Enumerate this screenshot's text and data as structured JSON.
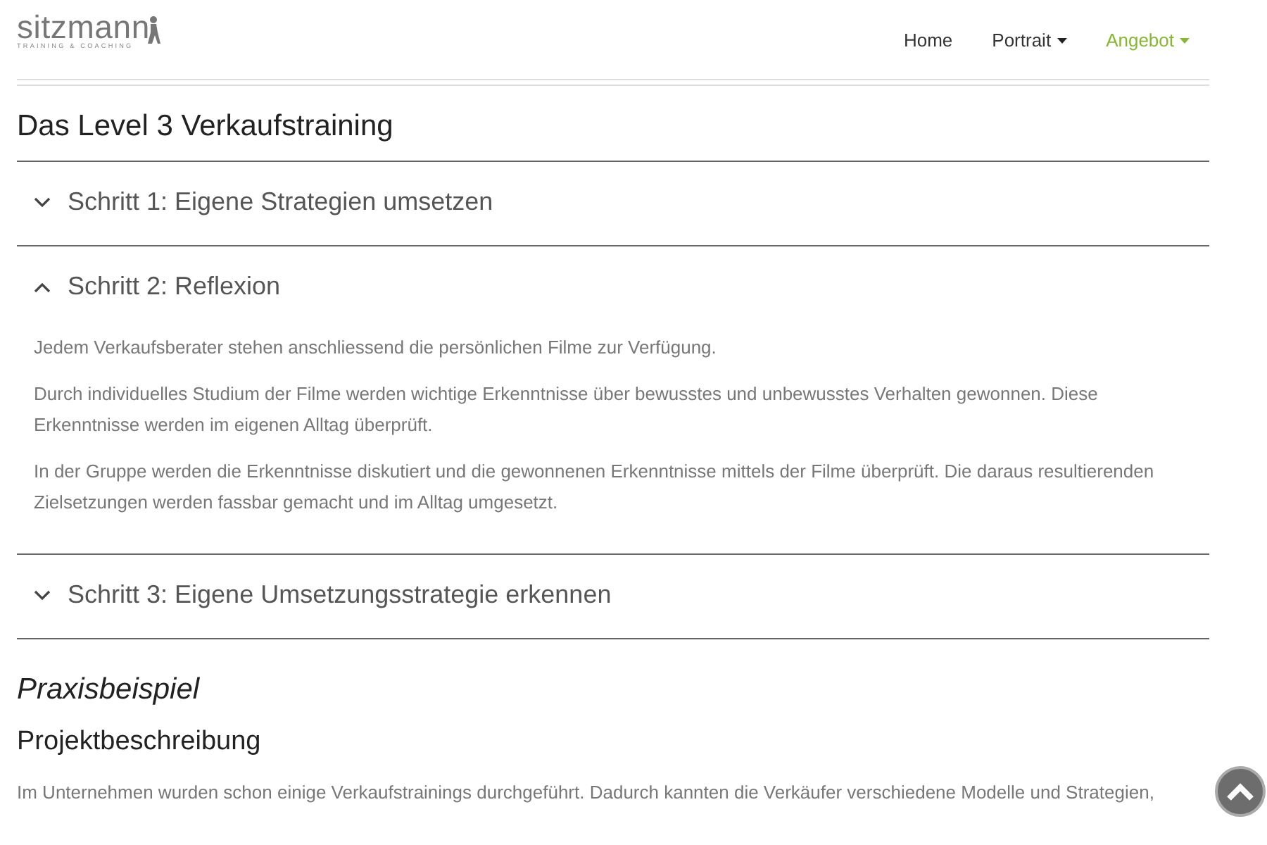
{
  "logo": {
    "name": "sitzmann",
    "tagline": "TRAINING & COACHING"
  },
  "nav": [
    {
      "label": "Home",
      "selected": false,
      "dropdown": false
    },
    {
      "label": "Portrait",
      "selected": false,
      "dropdown": true
    },
    {
      "label": "Angebot",
      "selected": true,
      "dropdown": true
    }
  ],
  "title": "Das Level 3 Verkaufstraining",
  "accordion": [
    {
      "title": "Schritt 1: Eigene Strategien umsetzen",
      "expanded": false
    },
    {
      "title": "Schritt 2: Reflexion",
      "expanded": true,
      "paragraphs": [
        "Jedem Verkaufsberater stehen anschliessend die persönlichen Filme zur Verfügung.",
        "Durch individuelles Studium der Filme werden wichtige Erkenntnisse über bewusstes und unbewusstes Verhalten gewonnen. Diese Erkenntnisse werden im eigenen Alltag überprüft.",
        "In der Gruppe werden die Erkenntnisse diskutiert und die gewonnenen Erkenntnisse mittels der Filme überprüft. Die daraus resultierenden Zielsetzungen werden fassbar gemacht und im Alltag umgesetzt."
      ]
    },
    {
      "title": "Schritt 3: Eigene Umsetzungsstrategie erkennen",
      "expanded": false
    }
  ],
  "section_title": "Praxisbeispiel",
  "subsection_title": "Projektbeschreibung",
  "body": "Im Unternehmen wurden schon einige Verkaufstrainings durchgeführt. Dadurch kannten die Verkäufer verschiedene Modelle und Strategien,"
}
